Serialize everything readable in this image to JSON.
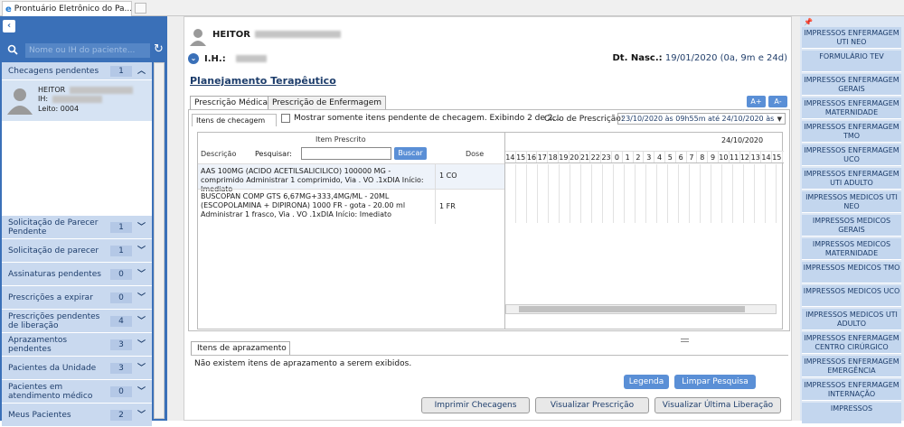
{
  "browser": {
    "tab_title": "Prontuário Eletrônico do Pa..."
  },
  "sidebar": {
    "search_placeholder": "Nome ou IH do paciente...",
    "sections": [
      {
        "label": "Checagens pendentes",
        "count": "1"
      },
      {
        "label": "Solicitação de Parecer Pendente",
        "count": "1"
      },
      {
        "label": "Solicitação de parecer",
        "count": "1"
      },
      {
        "label": "Assinaturas pendentes",
        "count": "0"
      },
      {
        "label": "Prescrições a expirar",
        "count": "0"
      },
      {
        "label": "Prescrições pendentes de liberação",
        "count": "4"
      },
      {
        "label": "Aprazamentos pendentes",
        "count": "3"
      },
      {
        "label": "Pacientes da Unidade",
        "count": "3"
      },
      {
        "label": "Pacientes em atendimento médico",
        "count": "0"
      },
      {
        "label": "Meus Pacientes",
        "count": "2"
      }
    ],
    "patient": {
      "name": "HEITOR",
      "ih_label": "IH:",
      "leito": "Leito: 0004"
    }
  },
  "header": {
    "patient_name": "HEITOR",
    "ih_label": "I.H.:",
    "dtnasc_label": "Dt. Nasc.:",
    "dtnasc_value": "19/01/2020 (0a, 9m e 24d)"
  },
  "page": {
    "title": "Planejamento Terapêutico"
  },
  "tabs": [
    "Prescrição Médica",
    "Prescrição de Enfermagem"
  ],
  "font_buttons": {
    "plus": "A+",
    "minus": "A-"
  },
  "prescription": {
    "itens_tab": "Itens de checagem",
    "checkbox_label": "Mostrar somente itens pendente de checagem. Exibindo 2 de 2...",
    "ciclo_label": "Ciclo de Prescrição:",
    "ciclo_value": "23/10/2020 às 09h55m até 24/10/2020 às"
  },
  "grid": {
    "item_header": "Item Prescrito",
    "descricao_header": "Descrição",
    "pesquisar_label": "Pesquisar:",
    "buscar_label": "Buscar",
    "dose_header": "Dose",
    "date": "24/10/2020",
    "hours": [
      "14",
      "15",
      "16",
      "17",
      "18",
      "19",
      "20",
      "21",
      "22",
      "23",
      "0",
      "1",
      "2",
      "3",
      "4",
      "5",
      "6",
      "7",
      "8",
      "9",
      "10",
      "11",
      "12",
      "13",
      "14",
      "15"
    ],
    "rows": [
      {
        "description": "AAS 100MG (ACIDO ACETILSALICILICO) 100000 MG - comprimido Administrar 1 comprimido, Via . VO .1xDIA Início: Imediato",
        "dose": "1 CO"
      },
      {
        "description": "BUSCOPAN COMP GTS 6,67MG+333,4MG/ML - 20ML (ESCOPOLAMINA + DIPIRONA) 1000 FR - gota - 20.00 ml Administrar 1 frasco, Via . VO .1xDIA Início: Imediato",
        "dose": "1 FR"
      }
    ]
  },
  "aprazamento": {
    "tab": "Itens de aprazamento",
    "empty": "Não existem itens de aprazamento a serem exibidos."
  },
  "actions": {
    "legenda": "Legenda",
    "limpar": "Limpar Pesquisa",
    "imprimir": "Imprimir Checagens",
    "visualizar": "Visualizar Prescrição",
    "visualizar_ultima": "Visualizar Última Liberação"
  },
  "right_menu": [
    "IMPRESSOS ENFERMAGEM UTI NEO",
    "FORMULÁRIO TEV",
    "IMPRESSOS ENFERMAGEM GERAIS",
    "IMPRESSOS ENFERMAGEM MATERNIDADE",
    "IMPRESSOS ENFERMAGEM TMO",
    "IMPRESSOS ENFERMAGEM UCO",
    "IMPRESSOS ENFERMAGEM UTI ADULTO",
    "IMPRESSOS MEDICOS UTI NEO",
    "IMPRESSOS MEDICOS GERAIS",
    "IMPRESSOS MEDICOS MATERNIDADE",
    "IMPRESSOS MEDICOS TMO",
    "IMPRESSOS MEDICOS UCO",
    "IMPRESSOS MEDICOS UTI ADULTO",
    "IMPRESSOS ENFERMAGEM CENTRO CIRÚRGICO",
    "IMPRESSOS ENFERMAGEM EMERGÊNCIA",
    "IMPRESSOS ENFERMAGEM INTERNAÇÃO",
    "IMPRESSOS"
  ]
}
